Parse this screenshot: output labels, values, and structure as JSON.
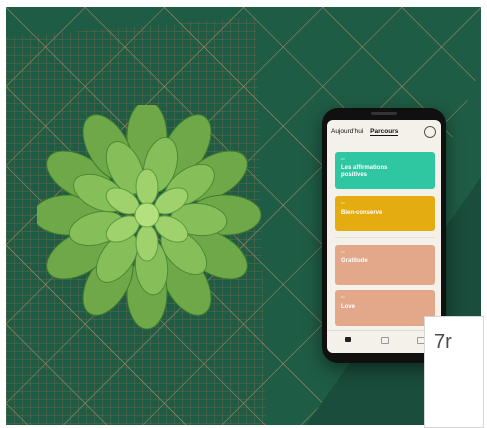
{
  "phone": {
    "tabs": [
      "Aujourd'hui",
      "Parcours"
    ],
    "cards": [
      {
        "title": "Les affirmations positives",
        "color": "#2fc7a2"
      },
      {
        "title": "Bien-conserve",
        "color": "#e4ac10"
      },
      {
        "title": "Gratitude",
        "color": "#e3a78a"
      },
      {
        "title": "Love",
        "color": "#e3a78a"
      }
    ]
  },
  "overlay": {
    "badge_text": "7r"
  }
}
